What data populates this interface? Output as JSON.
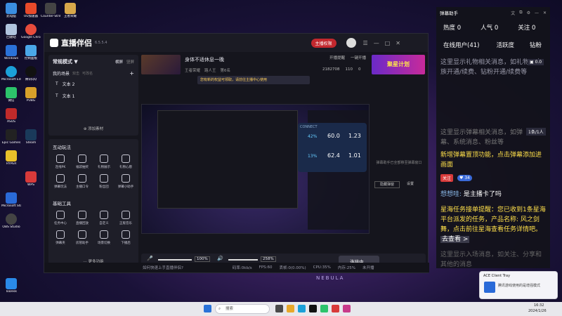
{
  "desktop": {
    "icons": [
      {
        "label": "此电脑"
      },
      {
        "label": "回收站"
      },
      {
        "label": "Google Chrome"
      },
      {
        "label": "Windows"
      },
      {
        "label": "控制面板"
      },
      {
        "label": "Microsoft Edge"
      },
      {
        "label": "腾讯QQ"
      },
      {
        "label": "微信"
      },
      {
        "label": "PUBG"
      },
      {
        "label": "ASUS"
      },
      {
        "label": "Epic Games"
      },
      {
        "label": "Steam"
      },
      {
        "label": "HYPER"
      },
      {
        "label": "WPS"
      },
      {
        "label": "Microsoft Store"
      },
      {
        "label": "OBS Studio"
      },
      {
        "label": "ToDesk"
      }
    ],
    "top_icons": [
      {
        "label": "UU加速器"
      },
      {
        "label": "Counter-Strike"
      },
      {
        "label": "王者荣耀"
      }
    ]
  },
  "app": {
    "logo": "直播伴侣",
    "version": "6.5.5.4",
    "trial_button": "主播权限",
    "header_buttons": [
      "开播提醒",
      "一键开播"
    ],
    "banner_ad": "聚星计划",
    "scene_mode": "常规模式 ▼",
    "scene_tabs": [
      "横屏",
      "竖屏"
    ],
    "scene_list_title": "我的场景",
    "scene_list_actions": [
      "双击",
      "可改名"
    ],
    "scenes": [
      "文本 2",
      "文本 1"
    ],
    "add_source": "添加素材",
    "interact_title": "互动玩法",
    "interact_tools": [
      "连线PK",
      "福袋抽奖",
      "礼物展示",
      "礼物心愿",
      "弹幕玩法",
      "主播口令",
      "粉丝团",
      "弹幕小助手"
    ],
    "basic_title": "基础工具",
    "basic_tools": [
      "任务中心",
      "直播回放",
      "自定义",
      "正版音乐",
      "弹幕夹",
      "房管助手",
      "场景切换",
      "下播后"
    ],
    "more_functions": "更多功能",
    "stream_title": "身体不适休息一晚",
    "stream_meta": [
      "王者荣耀",
      "路人王",
      "第6名"
    ],
    "stream_stats": [
      "2182708",
      "110",
      "0"
    ],
    "notice_bar": "您有新的权益可领取，请前往主播中心使用",
    "side_hint": "弹幕助手已全部移至弹幕窗口",
    "side_buttons": [
      "隐藏弹窗",
      "设置"
    ],
    "perf_panel": {
      "title": "CONNECT",
      "cpu": "42%",
      "gpu": "13%",
      "val1": "60.0",
      "val2": "1.23",
      "val3": "62.4",
      "val4": "1.01"
    },
    "audio": {
      "mic_label": "麦克风",
      "mic_pct": "100%",
      "spk_label": "扬声器",
      "spk_pct": "258%",
      "buttons": [
        "美颜",
        "录制",
        "设置"
      ]
    },
    "start_button": "连接中...",
    "status": [
      "如何快速上手直播伴侣?",
      "码率:0kb/s",
      "FPS:60",
      "丢帧:0(0.00%)",
      "CPU:35%",
      "内存:25%",
      "未开播"
    ]
  },
  "danmu": {
    "title": "弹幕助手",
    "stats": [
      {
        "label": "热度",
        "value": "0"
      },
      {
        "label": "人气",
        "value": "0"
      },
      {
        "label": "关注",
        "value": "0"
      }
    ],
    "tabs": [
      "在线用户(41)",
      "活跃度",
      "钻粉"
    ],
    "notice1": "这里显示礼物相关消息，如礼物、贵族开通/续费、钻粉开通/续费等",
    "gift_count": "0.0",
    "notice2": "这里显示弹幕相关消息，如弹幕、系统消息、粉丝等",
    "page_label": "1条/1人",
    "promo": "新增弹幕置顶功能，点击弹幕添加进画面",
    "user_badge": "关注",
    "user_level": "34",
    "user_name": "想想哇:",
    "user_text": "是主播卡了吗",
    "task_msg": "星海任务接单提醒：您已收到1条星海平台派发的任务，产品名称: 风之剑舞，点击前往星海查看任务详情吧。",
    "task_link": "去查看 >",
    "faded": "这里显示入场消息，如关注、分享和其他的消息"
  },
  "taskbar": {
    "search_placeholder": "搜索",
    "time": "16:32",
    "date": "2024/1/26"
  },
  "notification": {
    "title": "ACE Client Tray",
    "body": "腾讯游戏使用的是增强模式"
  }
}
